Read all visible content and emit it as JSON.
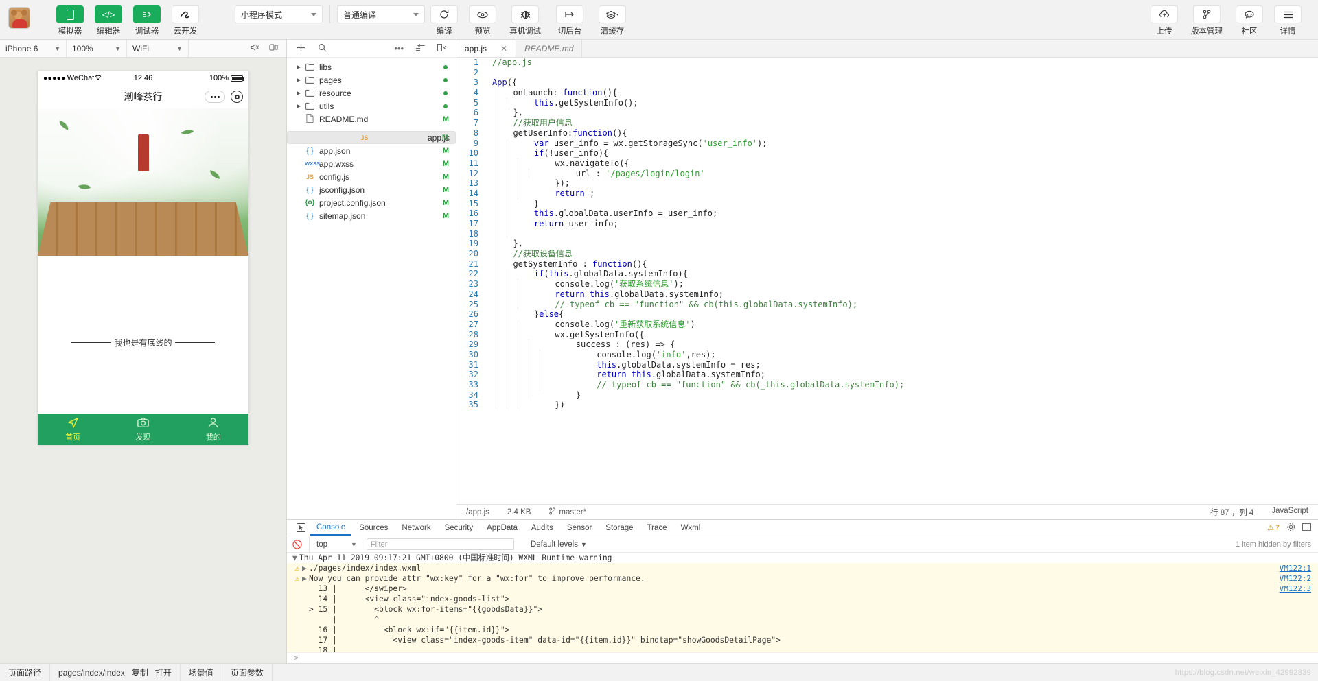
{
  "toolbar": {
    "avatar_name": "user-avatar",
    "left_buttons": [
      {
        "label": "模拟器",
        "icon": "phone-icon",
        "active": true
      },
      {
        "label": "编辑器",
        "icon": "code-icon",
        "active": true
      },
      {
        "label": "调试器",
        "icon": "debug-icon",
        "active": true
      },
      {
        "label": "云开发",
        "icon": "cloud-dev-icon",
        "active": false
      }
    ],
    "mode_select": "小程序模式",
    "compile_select": "普通编译",
    "mid_buttons": [
      {
        "label": "编译",
        "icon": "refresh-icon"
      },
      {
        "label": "预览",
        "icon": "eye-icon"
      },
      {
        "label": "真机调试",
        "icon": "bug-icon"
      },
      {
        "label": "切后台",
        "icon": "background-icon"
      },
      {
        "label": "清缓存",
        "icon": "layers-icon"
      }
    ],
    "right_buttons": [
      {
        "label": "上传",
        "icon": "upload-cloud-icon"
      },
      {
        "label": "版本管理",
        "icon": "branch-icon"
      },
      {
        "label": "社区",
        "icon": "community-icon"
      },
      {
        "label": "详情",
        "icon": "menu-icon"
      }
    ]
  },
  "simulator": {
    "device": "iPhone 6",
    "zoom": "100%",
    "network": "WiFi",
    "right_icons": [
      "mute-icon",
      "rotate-icon"
    ],
    "phone": {
      "status": {
        "carrier": "WeChat",
        "signal_dots": "●●●●●",
        "time": "12:46",
        "battery": "100%"
      },
      "nav_title": "潮峰茶行",
      "body_text": "我也是有底线的",
      "tabs": [
        {
          "label": "首页",
          "icon": "paper-plane-icon",
          "active": true
        },
        {
          "label": "发现",
          "icon": "camera-icon",
          "active": false
        },
        {
          "label": "我的",
          "icon": "person-icon",
          "active": false
        }
      ]
    }
  },
  "tree": {
    "toolbar_icons": [
      "add-icon",
      "search-icon",
      "more-icon",
      "collapse-icon",
      "layout-icon"
    ],
    "items": [
      {
        "name": "libs",
        "type": "folder",
        "badge": "dot"
      },
      {
        "name": "pages",
        "type": "folder",
        "badge": "dot"
      },
      {
        "name": "resource",
        "type": "folder",
        "badge": "dot"
      },
      {
        "name": "utils",
        "type": "folder",
        "badge": "dot"
      },
      {
        "name": "README.md",
        "type": "md",
        "badge": "M"
      },
      {
        "name": "app.js",
        "type": "js",
        "badge": "M",
        "selected": true
      },
      {
        "name": "app.json",
        "type": "json",
        "badge": "M"
      },
      {
        "name": "app.wxss",
        "type": "wxss",
        "badge": "M"
      },
      {
        "name": "config.js",
        "type": "js",
        "badge": "M"
      },
      {
        "name": "jsconfig.json",
        "type": "json",
        "badge": "M"
      },
      {
        "name": "project.config.json",
        "type": "pj",
        "badge": "M"
      },
      {
        "name": "sitemap.json",
        "type": "json",
        "badge": "M"
      }
    ]
  },
  "editor": {
    "tabs": [
      {
        "label": "app.js",
        "active": true,
        "closable": true
      },
      {
        "label": "README.md",
        "active": false,
        "closable": false
      }
    ],
    "lines": [
      {
        "n": 1,
        "indent": 0,
        "html": "<span class='cm'>//app.js</span>"
      },
      {
        "n": 2,
        "indent": 0,
        "html": ""
      },
      {
        "n": 3,
        "indent": 0,
        "html": "<span class='fn'>App</span>({"
      },
      {
        "n": 4,
        "indent": 1,
        "html": "  onLaunch: <span class='k'>function</span>(){"
      },
      {
        "n": 5,
        "indent": 2,
        "html": "    <span class='k'>this</span>.getSystemInfo();"
      },
      {
        "n": 6,
        "indent": 1,
        "html": "  },"
      },
      {
        "n": 7,
        "indent": 1,
        "html": "  <span class='cm'>//获取用户信息</span>"
      },
      {
        "n": 8,
        "indent": 1,
        "html": "  getUserInfo:<span class='k'>function</span>(){"
      },
      {
        "n": 9,
        "indent": 2,
        "html": "    <span class='k'>var</span> user_info = wx.getStorageSync(<span class='str'>'user_info'</span>);"
      },
      {
        "n": 10,
        "indent": 2,
        "html": "    <span class='k'>if</span>(!user_info){"
      },
      {
        "n": 11,
        "indent": 3,
        "html": "      wx.navigateTo({"
      },
      {
        "n": 12,
        "indent": 4,
        "html": "        url : <span class='str'>'/pages/login/login'</span>"
      },
      {
        "n": 13,
        "indent": 3,
        "html": "      });"
      },
      {
        "n": 14,
        "indent": 3,
        "html": "      <span class='k'>return</span> ;"
      },
      {
        "n": 15,
        "indent": 2,
        "html": "    }"
      },
      {
        "n": 16,
        "indent": 2,
        "html": "    <span class='k'>this</span>.globalData.userInfo = user_info;"
      },
      {
        "n": 17,
        "indent": 2,
        "html": "    <span class='k'>return</span> user_info;"
      },
      {
        "n": 18,
        "indent": 2,
        "html": ""
      },
      {
        "n": 19,
        "indent": 1,
        "html": "  },"
      },
      {
        "n": 20,
        "indent": 1,
        "html": "  <span class='cm'>//获取设备信息</span>"
      },
      {
        "n": 21,
        "indent": 1,
        "html": "  getSystemInfo : <span class='k'>function</span>(){"
      },
      {
        "n": 22,
        "indent": 2,
        "html": "    <span class='k'>if</span>(<span class='k'>this</span>.globalData.systemInfo){"
      },
      {
        "n": 23,
        "indent": 3,
        "html": "      console.log(<span class='str'>'获取系统信息'</span>);"
      },
      {
        "n": 24,
        "indent": 3,
        "html": "      <span class='k'>return</span> <span class='k'>this</span>.globalData.systemInfo;"
      },
      {
        "n": 25,
        "indent": 3,
        "html": "      <span class='cm'>// typeof cb == \"function\" &amp;&amp; cb(this.globalData.systemInfo);</span>"
      },
      {
        "n": 26,
        "indent": 2,
        "html": "    }<span class='k'>else</span>{"
      },
      {
        "n": 27,
        "indent": 3,
        "html": "      console.log(<span class='str'>'重新获取系统信息'</span>)"
      },
      {
        "n": 28,
        "indent": 3,
        "html": "      wx.getSystemInfo({"
      },
      {
        "n": 29,
        "indent": 4,
        "html": "        success : (res) =&gt; {"
      },
      {
        "n": 30,
        "indent": 5,
        "html": "          console.log(<span class='str'>'info'</span>,res);"
      },
      {
        "n": 31,
        "indent": 5,
        "html": "          <span class='k'>this</span>.globalData.systemInfo = res;"
      },
      {
        "n": 32,
        "indent": 5,
        "html": "          <span class='k'>return</span> <span class='k'>this</span>.globalData.systemInfo;"
      },
      {
        "n": 33,
        "indent": 5,
        "html": "          <span class='cm'>// typeof cb == \"function\" &amp;&amp; cb(_this.globalData.systemInfo);</span>"
      },
      {
        "n": 34,
        "indent": 4,
        "html": "        }"
      },
      {
        "n": 35,
        "indent": 3,
        "html": "      })"
      }
    ],
    "status": {
      "path": "/app.js",
      "size": "2.4 KB",
      "branch": "master*",
      "cursor": "行 87 ，列 4",
      "language": "JavaScript"
    }
  },
  "console": {
    "tabs": [
      "Console",
      "Sources",
      "Network",
      "Security",
      "AppData",
      "Audits",
      "Sensor",
      "Storage",
      "Trace",
      "Wxml"
    ],
    "active_tab": "Console",
    "warn_count": "7",
    "context": "top",
    "filter_placeholder": "Filter",
    "levels": "Default levels",
    "hidden_note": "1 item hidden by filters",
    "log": [
      {
        "kind": "header",
        "text": "Thu Apr 11 2019 09:17:21 GMT+0800 (中国标准时间) WXML Runtime warning",
        "vm": ""
      },
      {
        "kind": "warn",
        "text": "./pages/index/index.wxml",
        "vm": "VM122:1"
      },
      {
        "kind": "warn",
        "text": "Now you can provide attr \"wx:key\" for a \"wx:for\" to improve performance.",
        "vm": "VM122:2"
      },
      {
        "kind": "code",
        "text": "  13 |      </swiper>",
        "vm": "VM122:3"
      },
      {
        "kind": "code",
        "text": "  14 |      <view class=\"index-goods-list\">",
        "vm": ""
      },
      {
        "kind": "codesel",
        "text": "> 15 |        <block wx:for-items=\"{{goodsData}}\">",
        "vm": ""
      },
      {
        "kind": "caret",
        "text": "     |        ^",
        "vm": ""
      },
      {
        "kind": "code",
        "text": "  16 |          <block wx:if=\"{{item.id}}\">",
        "vm": ""
      },
      {
        "kind": "code",
        "text": "  17 |            <view class=\"index-goods-item\" data-id=\"{{item.id}}\" bindtap=\"showGoodsDetailPage\">",
        "vm": ""
      },
      {
        "kind": "code",
        "text": "  18 |",
        "vm": ""
      }
    ],
    "prompt": ">"
  },
  "bottom": {
    "label_path": "页面路径",
    "value_path": "pages/index/index",
    "copy": "复制",
    "open": "打开",
    "tab_scene": "场景值",
    "tab_params": "页面参数",
    "watermark": "https://blog.csdn.net/weixin_42992839"
  }
}
